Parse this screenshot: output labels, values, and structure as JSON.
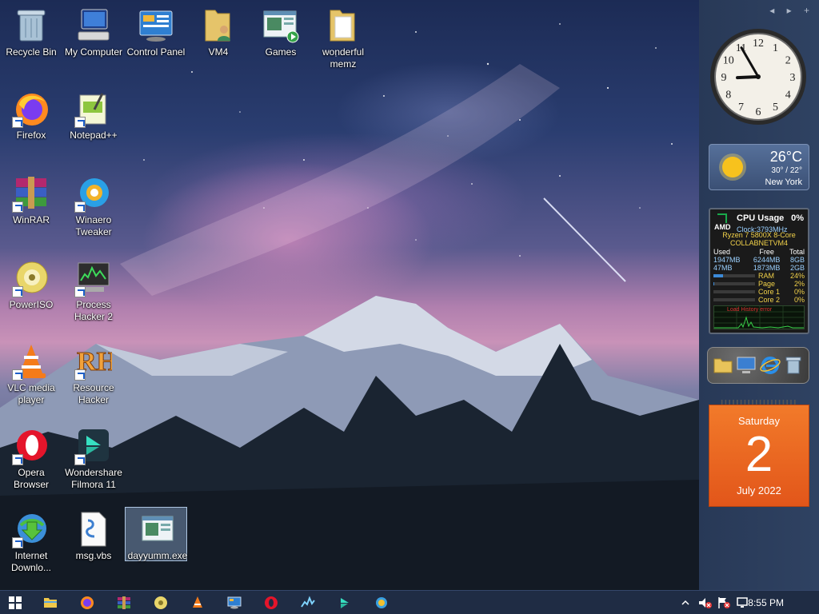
{
  "desktop": {
    "icons": [
      {
        "label": "Recycle Bin",
        "icon": "recycle-bin-icon"
      },
      {
        "label": "My Computer",
        "icon": "computer-icon"
      },
      {
        "label": "Control Panel",
        "icon": "control-panel-icon"
      },
      {
        "label": "VM4",
        "icon": "user-folder-icon"
      },
      {
        "label": "Games",
        "icon": "games-icon"
      },
      {
        "label": "wonderful memz",
        "icon": "folder-icon"
      },
      {
        "label": "Firefox",
        "icon": "firefox-icon"
      },
      {
        "label": "Notepad++",
        "icon": "notepadpp-icon"
      },
      {
        "label": "WinRAR",
        "icon": "winrar-icon"
      },
      {
        "label": "Winaero Tweaker",
        "icon": "winaero-icon"
      },
      {
        "label": "PowerISO",
        "icon": "poweriso-icon"
      },
      {
        "label": "Process Hacker 2",
        "icon": "process-hacker-icon"
      },
      {
        "label": "VLC media player",
        "icon": "vlc-icon"
      },
      {
        "label": "Resource Hacker",
        "icon": "resource-hacker-icon"
      },
      {
        "label": "Opera Browser",
        "icon": "opera-icon"
      },
      {
        "label": "Wondershare Filmora 11",
        "icon": "filmora-icon"
      },
      {
        "label": "Internet Downlo...",
        "icon": "idm-icon"
      },
      {
        "label": "msg.vbs",
        "icon": "vbs-script-icon"
      },
      {
        "label": "dayyumm.exe",
        "icon": "exe-file-icon"
      }
    ]
  },
  "sidebar": {
    "controls": "◂ ▸ +",
    "clock": {
      "hours": 8,
      "minutes": 55,
      "numerals": [
        "12",
        "1",
        "2",
        "3",
        "4",
        "5",
        "6",
        "7",
        "8",
        "9",
        "10",
        "11"
      ]
    },
    "weather": {
      "temp": "26°C",
      "range": "30° / 22°",
      "city": "New York"
    },
    "cpu": {
      "brand": "AMD",
      "title": "CPU Usage",
      "percent": "0%",
      "clock": "Clock:3793MHz",
      "model": "Ryzen 7 5800X 8-Core",
      "host": "COLLABNETVM4",
      "mem_headers": [
        "Used",
        "Free",
        "Total"
      ],
      "mem_rows": [
        [
          "1947MB",
          "6244MB",
          "8GB"
        ],
        [
          "47MB",
          "1873MB",
          "2GB"
        ]
      ],
      "meters": [
        {
          "name": "RAM",
          "value": "24%",
          "fill": 0.24
        },
        {
          "name": "Page",
          "value": "2%",
          "fill": 0.02
        },
        {
          "name": "Core 1",
          "value": "0%",
          "fill": 0.0
        },
        {
          "name": "Core 2",
          "value": "0%",
          "fill": 0.0
        }
      ],
      "graph_error": "Load History error"
    },
    "calendar": {
      "weekday": "Saturday",
      "day": "2",
      "month": "July 2022"
    }
  },
  "taskbar": {
    "items": [
      "start-icon",
      "file-explorer-icon",
      "firefox-icon",
      "winrar-icon",
      "poweriso-icon",
      "vlc-icon",
      "control-panel-icon",
      "opera-icon",
      "process-hacker-icon",
      "filmora-icon",
      "app-icon"
    ],
    "time": "8:55 PM"
  },
  "colors": {
    "accent": "#e2561a",
    "taskbar": "#1f2c44",
    "sidebar": "#2f4262"
  }
}
